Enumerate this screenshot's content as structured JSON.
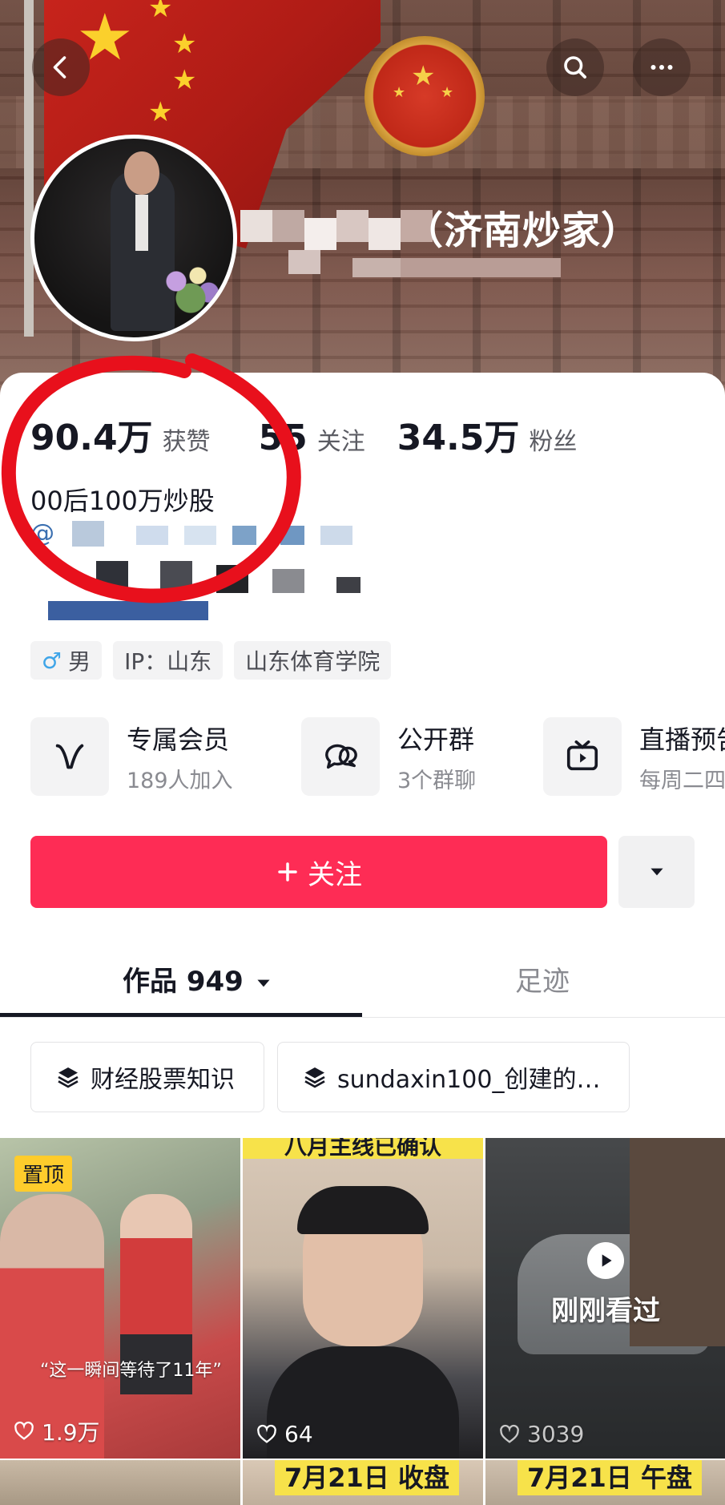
{
  "header": {
    "name_suffix": "（济南炒家）"
  },
  "stats": [
    {
      "value": "90.4万",
      "label": "获赞"
    },
    {
      "value": "55",
      "label": "关注"
    },
    {
      "value": "34.5万",
      "label": "粉丝"
    }
  ],
  "bio": "00后100万炒股",
  "mention_prefix": "@",
  "tags": [
    {
      "icon": "male-icon",
      "text": "男"
    },
    {
      "text": "IP：山东"
    },
    {
      "text": "山东体育学院"
    }
  ],
  "features": [
    {
      "icon": "v-membership-icon",
      "title": "专属会员",
      "subtitle": "189人加入"
    },
    {
      "icon": "group-chat-icon",
      "title": "公开群",
      "subtitle": "3个群聊"
    },
    {
      "icon": "tv-icon",
      "title": "直播预告",
      "subtitle": "每周二四"
    }
  ],
  "follow_button": {
    "label": "关注",
    "icon": "plus-icon"
  },
  "tabs": [
    {
      "label": "作品 949",
      "active": true
    },
    {
      "label": "足迹",
      "active": false
    }
  ],
  "collections": [
    {
      "icon": "layers-icon",
      "label": "财经股票知识"
    },
    {
      "icon": "layers-icon",
      "label": "sundaxin100_创建的…"
    }
  ],
  "videos": [
    {
      "pinned_label": "置顶",
      "caption": "“这一瞬间等待了11年”",
      "likes": "1.9万"
    },
    {
      "banner": "八月主线已确认",
      "likes": "64"
    },
    {
      "watched_label": "刚刚看过",
      "likes": "3039"
    }
  ],
  "videos_row2": [
    {
      "label": ""
    },
    {
      "label": "7月21日 收盘"
    },
    {
      "label": "7月21日 午盘"
    }
  ],
  "colors": {
    "accent": "#fe2c55",
    "text_primary": "#161823",
    "text_secondary": "#8a8b91",
    "annotation_circle": "#e8101c"
  }
}
